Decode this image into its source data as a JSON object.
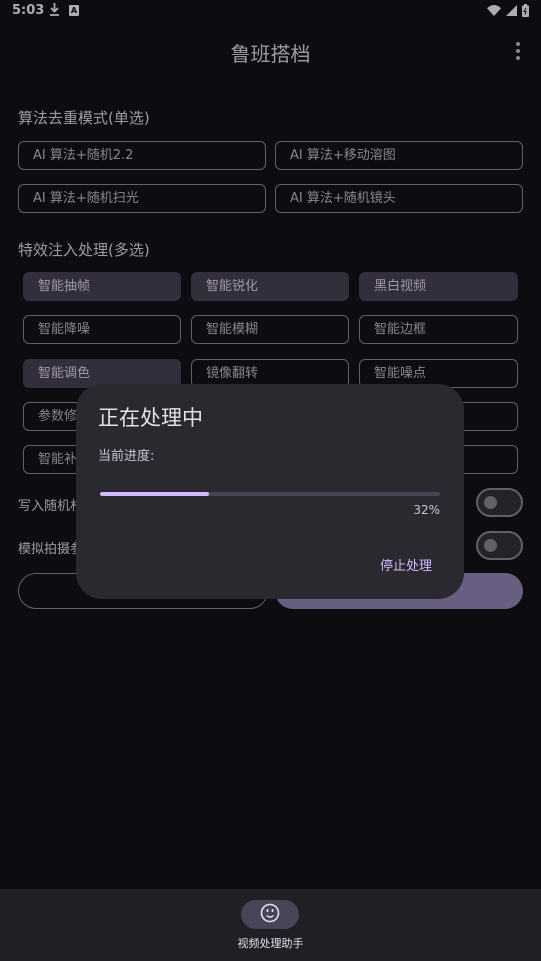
{
  "status": {
    "time": "5:03",
    "download_icon": "download-arrow",
    "notif_badge": "A"
  },
  "app": {
    "title": "鲁班搭档",
    "more_icon": "more-vert"
  },
  "dedupe": {
    "title": "算法去重模式(单选)",
    "options": [
      "AI 算法+随机2.2",
      "AI 算法+移动溶图",
      "AI 算法+随机扫光",
      "AI 算法+随机镜头"
    ]
  },
  "effects": {
    "title": "特效注入处理(多选)",
    "chips": [
      {
        "label": "智能抽帧",
        "selected": true
      },
      {
        "label": "智能锐化",
        "selected": true
      },
      {
        "label": "黑白视频",
        "selected": true
      },
      {
        "label": "智能降噪",
        "selected": false
      },
      {
        "label": "智能模糊",
        "selected": false
      },
      {
        "label": "智能边框",
        "selected": false
      },
      {
        "label": "智能调色",
        "selected": true
      },
      {
        "label": "镜像翻转",
        "selected": false
      },
      {
        "label": "智能噪点",
        "selected": false
      },
      {
        "label": "参数修",
        "selected": false
      },
      {
        "label": "智能补",
        "selected": false
      }
    ]
  },
  "settings": {
    "row1_label": "写入随机杉",
    "row2_label": "模拟拍摄参"
  },
  "dialog": {
    "title": "正在处理中",
    "progress_label": "当前进度:",
    "progress_value": 0.32,
    "progress_text": "32%",
    "stop_label": "停止处理"
  },
  "bottom_nav": {
    "icon": "smiley-face-icon",
    "label": "视频处理助手"
  },
  "colors": {
    "background": "#141218",
    "chip_selected": "#4a4458",
    "primary": "#d0bcff",
    "dialog": "#2b2930"
  }
}
